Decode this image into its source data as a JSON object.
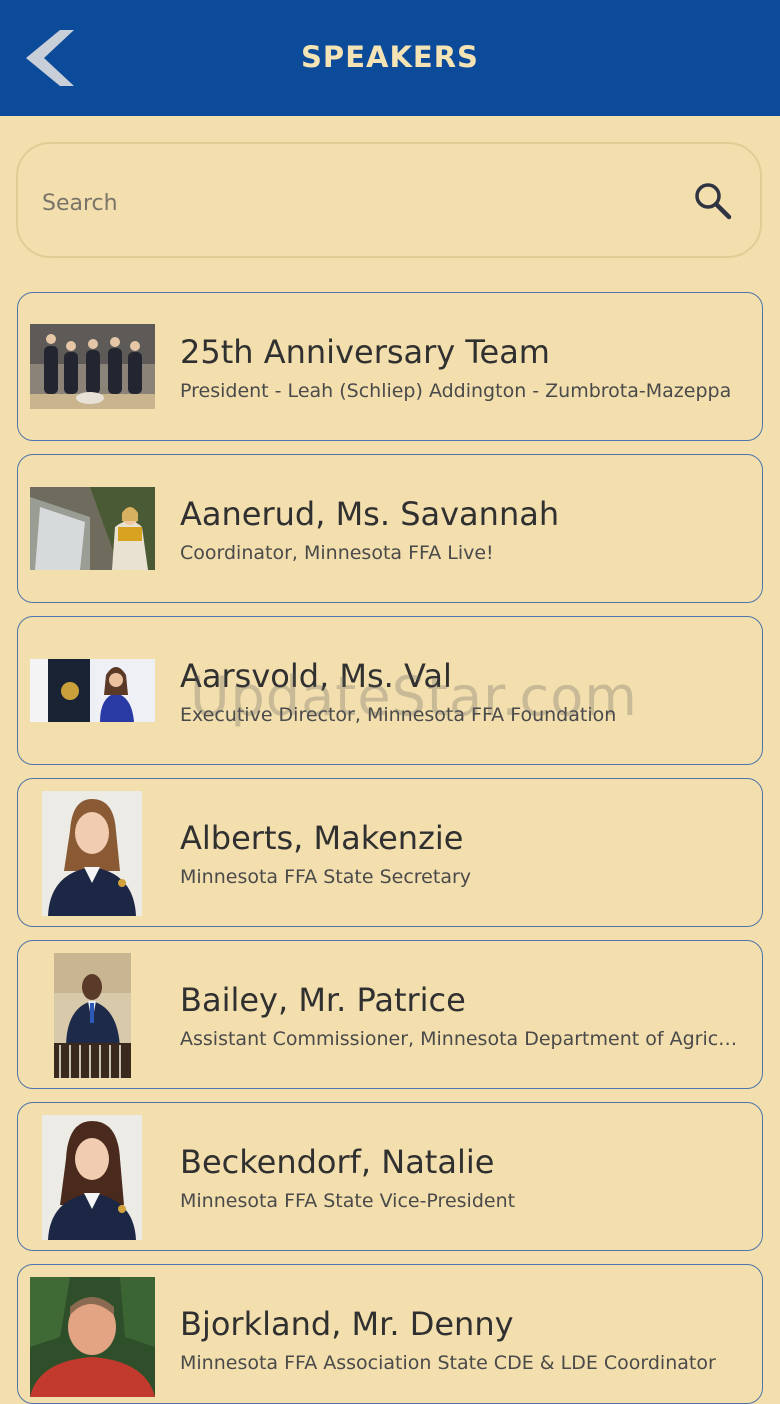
{
  "header": {
    "title": "SPEAKERS"
  },
  "search": {
    "placeholder": "Search"
  },
  "speakers": [
    {
      "name": "25th Anniversary Team",
      "subtitle": "President - Leah (Schliep) Addington - Zumbrota-Mazeppa"
    },
    {
      "name": "Aanerud, Ms. Savannah",
      "subtitle": "Coordinator, Minnesota FFA Live!"
    },
    {
      "name": "Aarsvold, Ms. Val",
      "subtitle": "Executive Director, Minnesota FFA Foundation"
    },
    {
      "name": "Alberts, Makenzie",
      "subtitle": "Minnesota FFA State Secretary"
    },
    {
      "name": "Bailey, Mr. Patrice",
      "subtitle": "Assistant Commissioner, Minnesota Department of Agriculture"
    },
    {
      "name": "Beckendorf, Natalie",
      "subtitle": "Minnesota FFA  State Vice-President"
    },
    {
      "name": "Bjorkland, Mr. Denny",
      "subtitle": "Minnesota FFA Association State CDE & LDE Coordinator"
    }
  ],
  "watermark": "UpdateStar.com",
  "colors": {
    "header_bg": "#0b4b9a",
    "header_text": "#f4e3b4",
    "page_bg": "#f3dfae",
    "card_border": "#4f74a8"
  }
}
